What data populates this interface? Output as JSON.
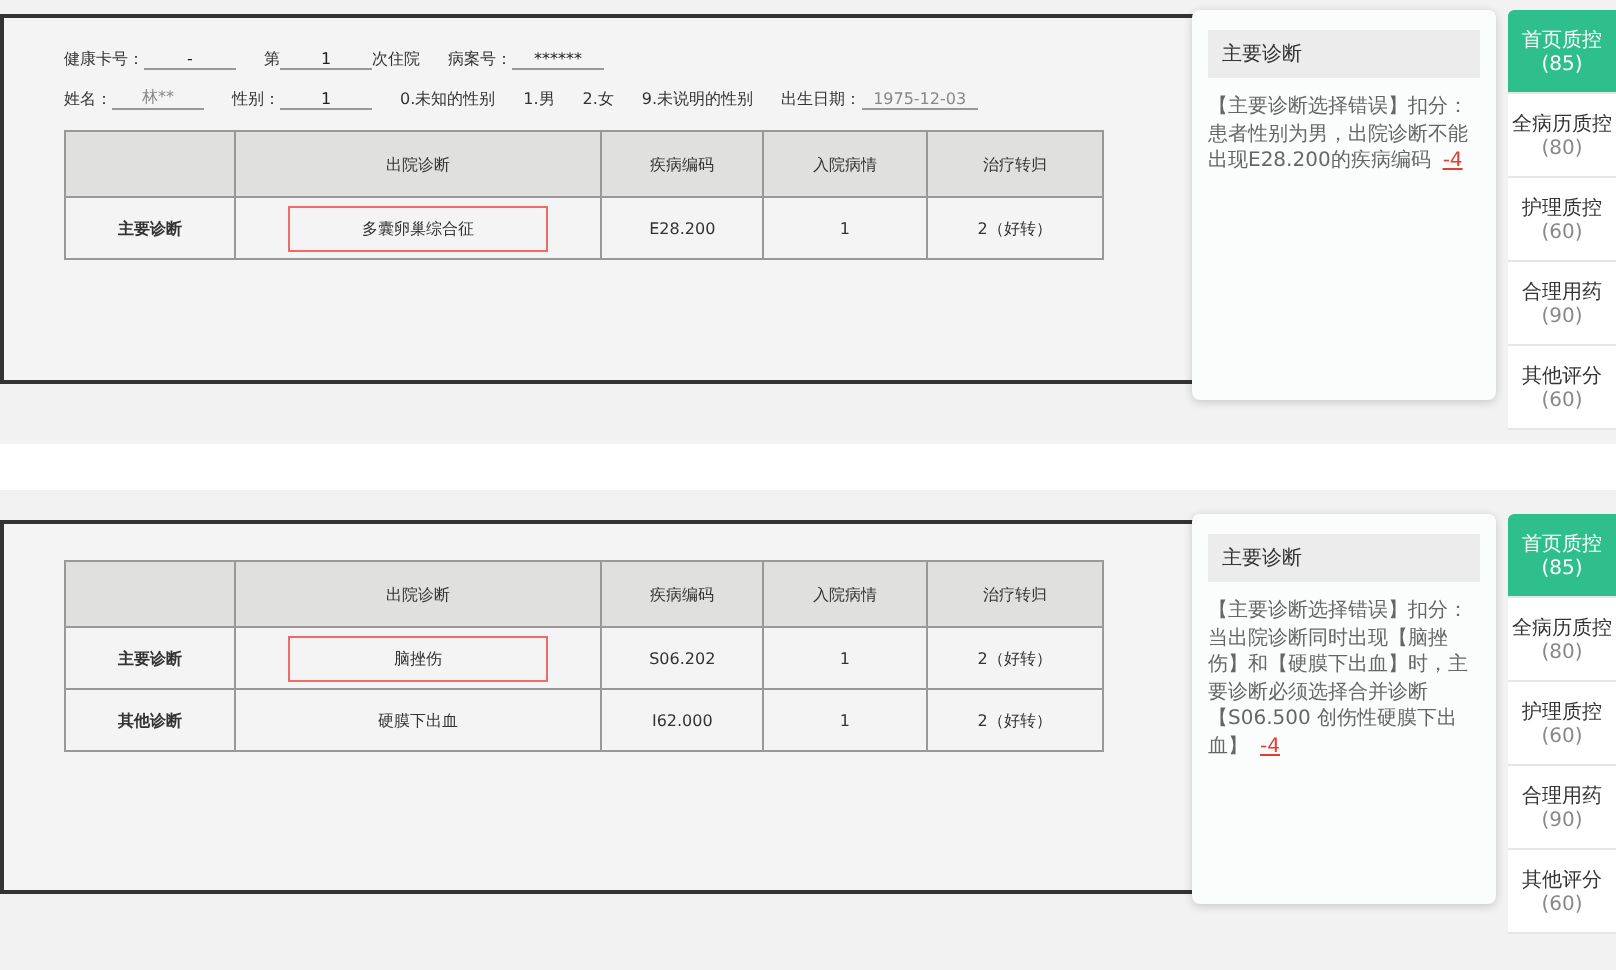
{
  "panels": [
    {
      "form": {
        "rows": [
          [
            {
              "kind": "field",
              "label": "健康卡号：",
              "value": "-",
              "muted": false
            },
            {
              "kind": "field",
              "label": "第",
              "value": "1",
              "suffix": "次住院",
              "muted": false
            },
            {
              "kind": "field",
              "label": "病案号：",
              "value": "******",
              "muted": false
            }
          ],
          [
            {
              "kind": "field",
              "label": "姓名：",
              "value": "林**",
              "muted": true
            },
            {
              "kind": "field",
              "label": "性别：",
              "value": "1",
              "muted": false
            },
            {
              "kind": "note",
              "text": "0.未知的性别"
            },
            {
              "kind": "note",
              "text": "1.男"
            },
            {
              "kind": "note",
              "text": "2.女"
            },
            {
              "kind": "note",
              "text": "9.未说明的性别"
            },
            {
              "kind": "field",
              "label": "出生日期：",
              "value": "1975-12-03",
              "muted": true
            }
          ]
        ]
      },
      "table": {
        "columns": [
          "",
          "出院诊断",
          "疾病编码",
          "入院病情",
          "治疗转归"
        ],
        "rows": [
          {
            "label": "主要诊断",
            "diagnosis": "多囊卵巢综合征",
            "flagged": true,
            "code": "E28.200",
            "admission": "1",
            "outcome": "2（好转）"
          }
        ]
      },
      "popup": {
        "title": "主要诊断",
        "message": "【主要诊断选择错误】扣分：患者性别为男，出院诊断不能出现E28.200的疾病编码",
        "deduction": "-4"
      },
      "tabs": [
        {
          "label": "首页质控",
          "score": "(85)",
          "selected": true
        },
        {
          "label": "全病历质控",
          "score": "(80)",
          "selected": false
        },
        {
          "label": "护理质控",
          "score": "(60)",
          "selected": false
        },
        {
          "label": "合理用药",
          "score": "(90)",
          "selected": false
        },
        {
          "label": "其他评分",
          "score": "(60)",
          "selected": false
        }
      ]
    },
    {
      "table": {
        "columns": [
          "",
          "出院诊断",
          "疾病编码",
          "入院病情",
          "治疗转归"
        ],
        "rows": [
          {
            "label": "主要诊断",
            "diagnosis": "脑挫伤",
            "flagged": true,
            "code": "S06.202",
            "admission": "1",
            "outcome": "2（好转）"
          },
          {
            "label": "其他诊断",
            "diagnosis": "硬膜下出血",
            "flagged": false,
            "code": "I62.000",
            "admission": "1",
            "outcome": "2（好转）"
          }
        ]
      },
      "popup": {
        "title": "主要诊断",
        "message": "【主要诊断选择错误】扣分：当出院诊断同时出现【脑挫伤】和【硬膜下出血】时，主要诊断必须选择合并诊断【S06.500 创伤性硬膜下出血】",
        "deduction": "-4"
      },
      "tabs": [
        {
          "label": "首页质控",
          "score": "(85)",
          "selected": true
        },
        {
          "label": "全病历质控",
          "score": "(80)",
          "selected": false
        },
        {
          "label": "护理质控",
          "score": "(60)",
          "selected": false
        },
        {
          "label": "合理用药",
          "score": "(90)",
          "selected": false
        },
        {
          "label": "其他评分",
          "score": "(60)",
          "selected": false
        }
      ]
    }
  ]
}
